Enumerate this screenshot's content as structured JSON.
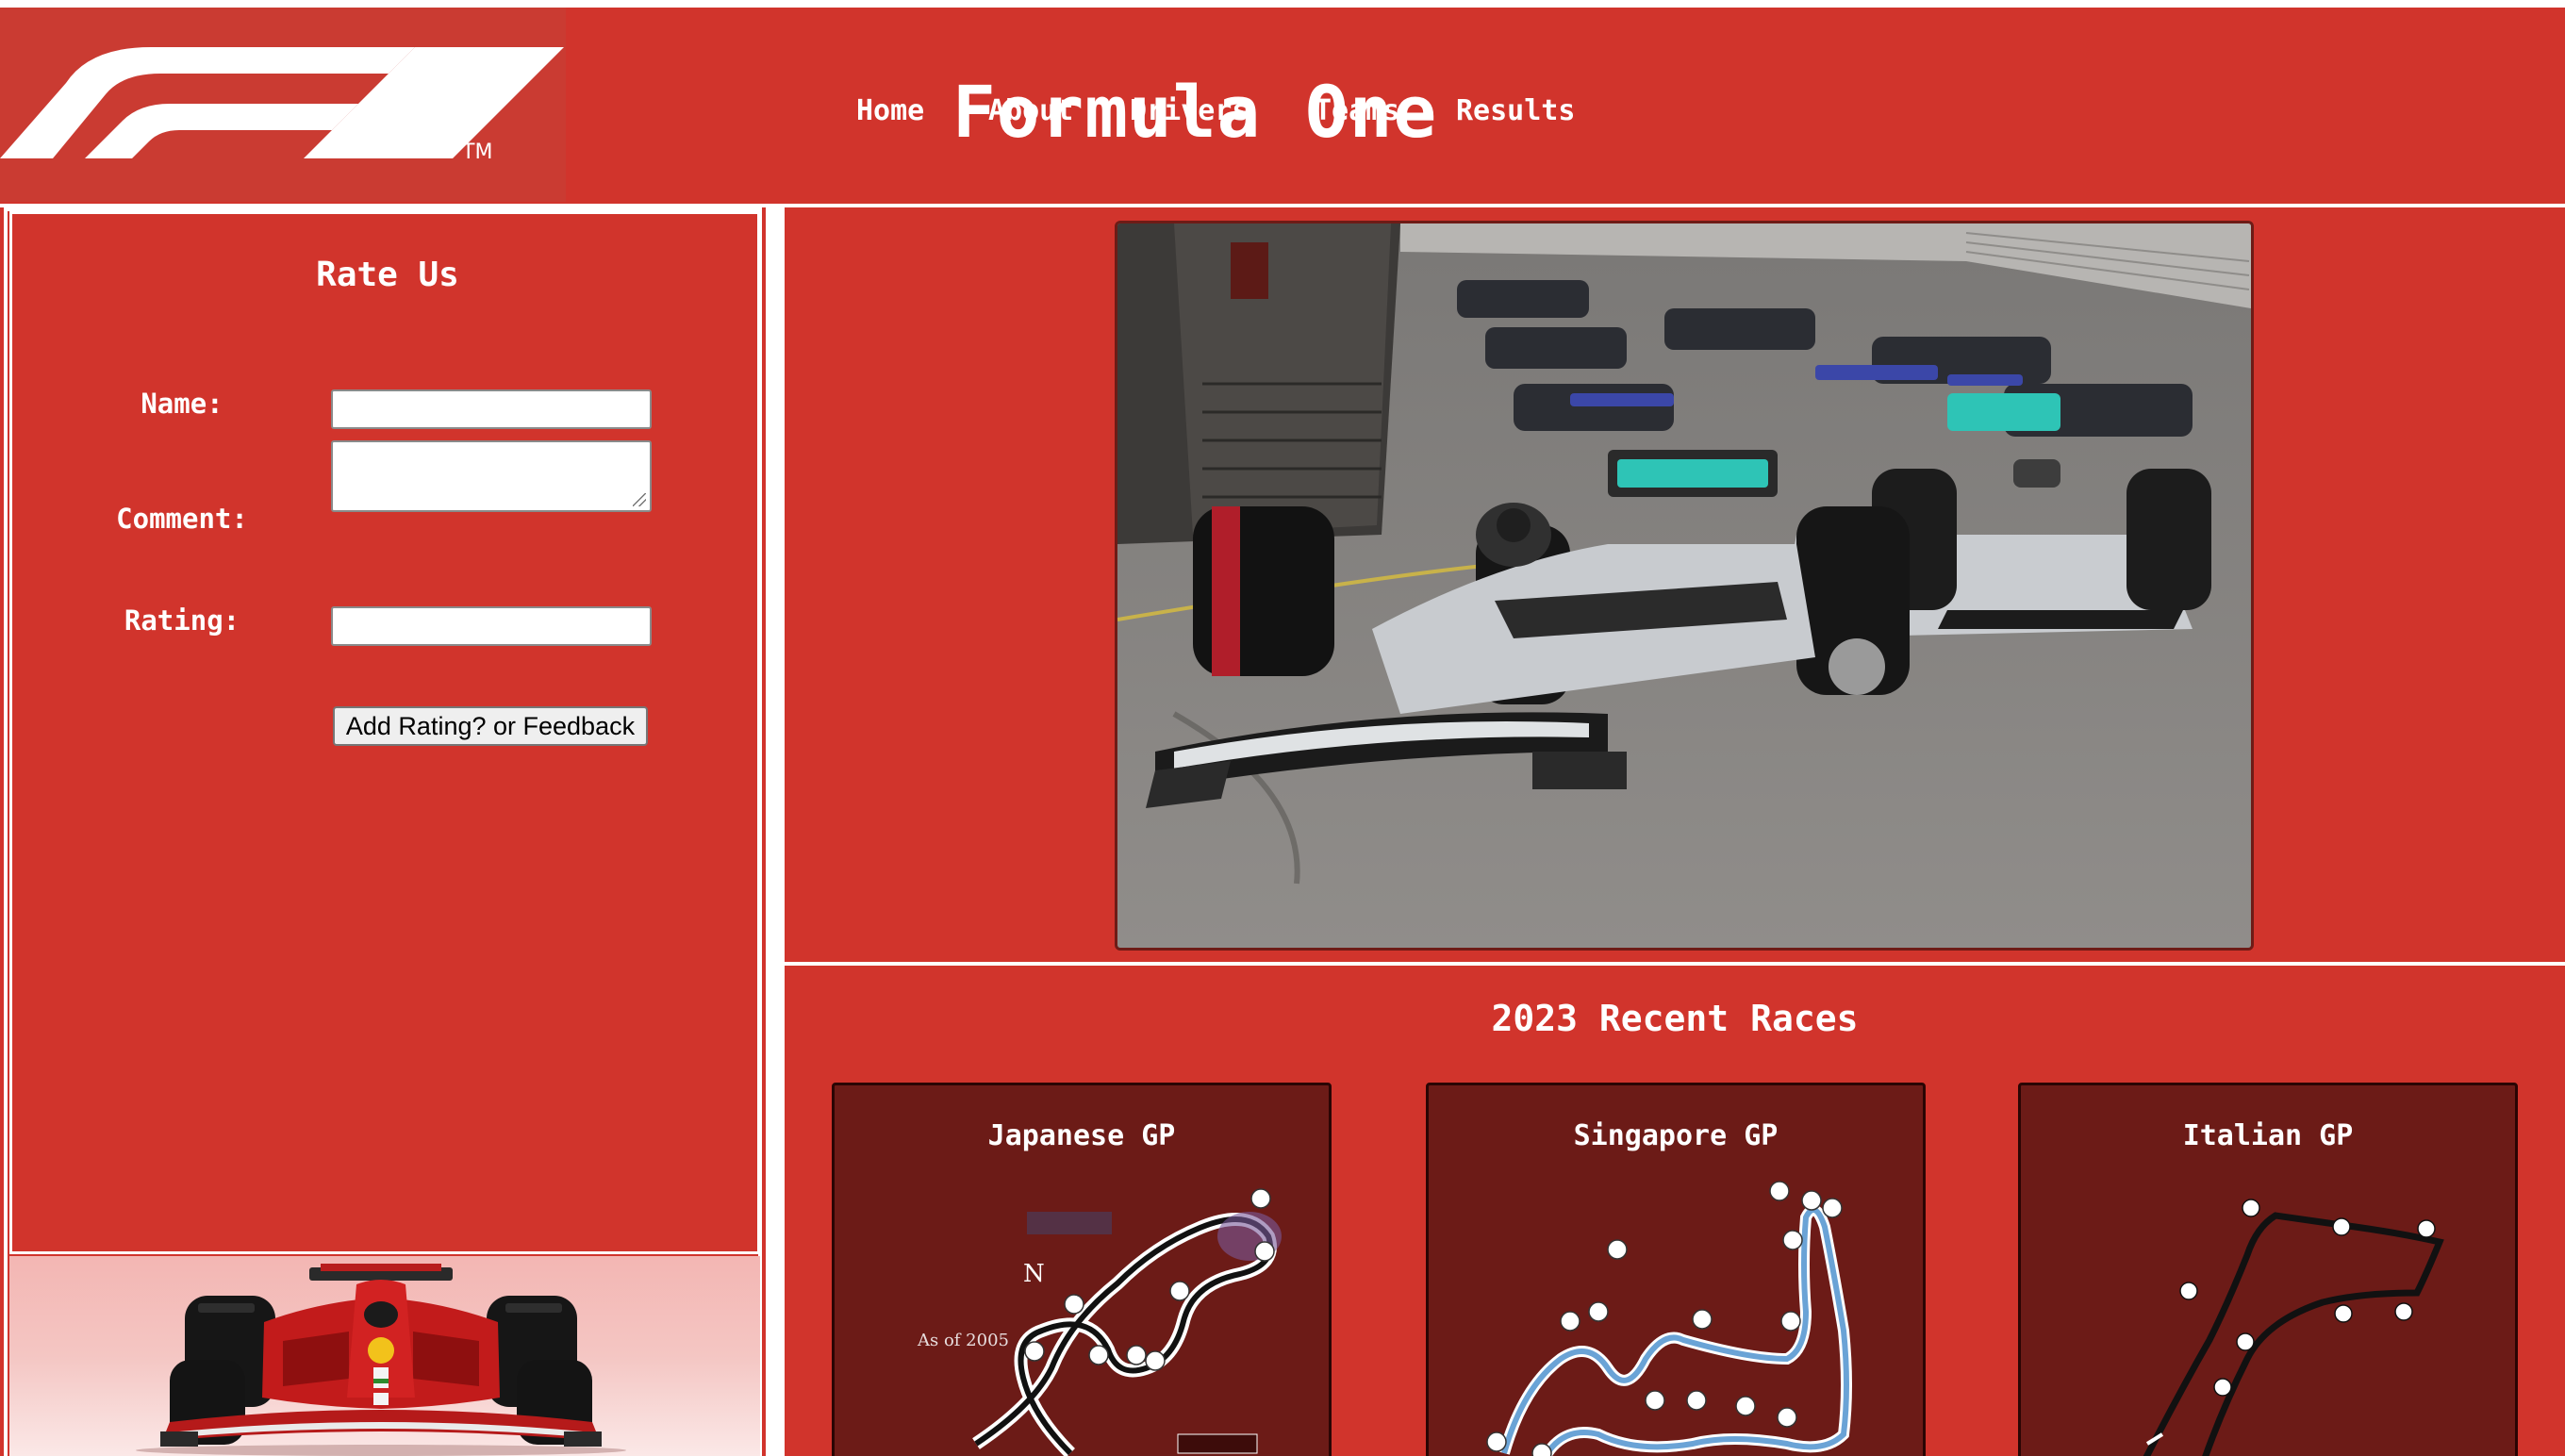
{
  "header": {
    "logo_icon": "f1-logo",
    "logo_trademark": "TM",
    "title": "Formula One",
    "nav": [
      {
        "label": "Home"
      },
      {
        "label": "About"
      },
      {
        "label": "Drivers"
      },
      {
        "label": "Teams"
      },
      {
        "label": "Results"
      }
    ]
  },
  "rate_form": {
    "title": "Rate Us",
    "name_label": "Name:",
    "name_value": "",
    "comment_label": "Comment:",
    "comment_value": "",
    "rating_label": "Rating:",
    "rating_value": "",
    "submit_label": "Add Rating? or Feedback"
  },
  "hero": {
    "image_icon": "race-cars-photo"
  },
  "recent_races": {
    "title": "2023 Recent Races",
    "races": [
      {
        "name": "Japanese GP",
        "map_icon": "suzuka-circuit-map",
        "note": "As of 2005"
      },
      {
        "name": "Singapore GP",
        "map_icon": "marina-bay-circuit-map"
      },
      {
        "name": "Italian GP",
        "map_icon": "monza-circuit-map"
      }
    ]
  },
  "colors": {
    "primary_red": "#d1342c",
    "card_dark_red": "#6c1b17",
    "text_white": "#ffffff"
  }
}
